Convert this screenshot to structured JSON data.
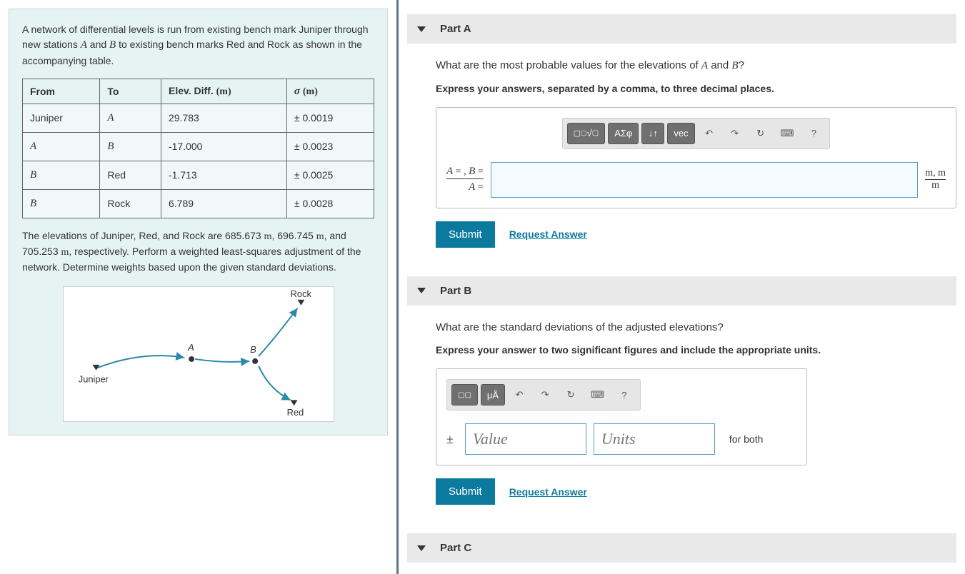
{
  "problem": {
    "intro_pre": "A network of differential levels is run from existing bench mark Juniper through new stations ",
    "var_A": "A",
    "intro_mid": " and ",
    "var_B": "B",
    "intro_post": " to existing bench marks Red and Rock as shown in the accompanying table.",
    "table": {
      "headers": [
        "From",
        "To",
        "Elev. Diff. (m)",
        "σ (m)"
      ],
      "rows": [
        {
          "from": "Juniper",
          "to": "A",
          "diff": "29.783",
          "sigma": "± 0.0019"
        },
        {
          "from": "A",
          "to": "B",
          "diff": "-17.000",
          "sigma": "± 0.0023"
        },
        {
          "from": "B",
          "to": "Red",
          "diff": "-1.713",
          "sigma": "± 0.0025"
        },
        {
          "from": "B",
          "to": "Rock",
          "diff": "6.789",
          "sigma": "± 0.0028"
        }
      ]
    },
    "footer": "The elevations of Juniper, Red, and Rock are 685.673 m, 696.745 m, and 705.253 m, respectively. Perform a weighted least-squares adjustment of the network. Determine weights based upon the given standard deviations.",
    "diagram_labels": {
      "juniper": "Juniper",
      "a": "A",
      "b": "B",
      "rock": "Rock",
      "red": "Red"
    }
  },
  "partA": {
    "title": "Part A",
    "question_pre": "What are the most probable values for the elevations of ",
    "question_mid": " and ",
    "question_post": "?",
    "instruction": "Express your answers, separated by a comma, to three decimal places.",
    "prefix_line1": "A = , B =",
    "prefix_line2": "A =",
    "suffix_line1": "m, m",
    "suffix_line2": "m",
    "submit": "Submit",
    "request": "Request Answer",
    "input_value": ""
  },
  "partB": {
    "title": "Part B",
    "question": "What are the standard deviations of the adjusted elevations?",
    "instruction": "Express your answer to two significant figures and include the appropriate units.",
    "pm": "±",
    "value_placeholder": "Value",
    "units_placeholder": "Units",
    "suffix": "for both",
    "submit": "Submit",
    "request": "Request Answer"
  },
  "partC": {
    "title": "Part C"
  },
  "toolbar": {
    "templates": "▢√▢",
    "greek": "ΑΣφ",
    "subscript": "↓↑",
    "vec": "vec",
    "undo": "↶",
    "redo": "↷",
    "reset": "↻",
    "keyboard": "⌨",
    "help": "?",
    "units_tmpl": "▢▢",
    "units_btn": "μÅ"
  }
}
